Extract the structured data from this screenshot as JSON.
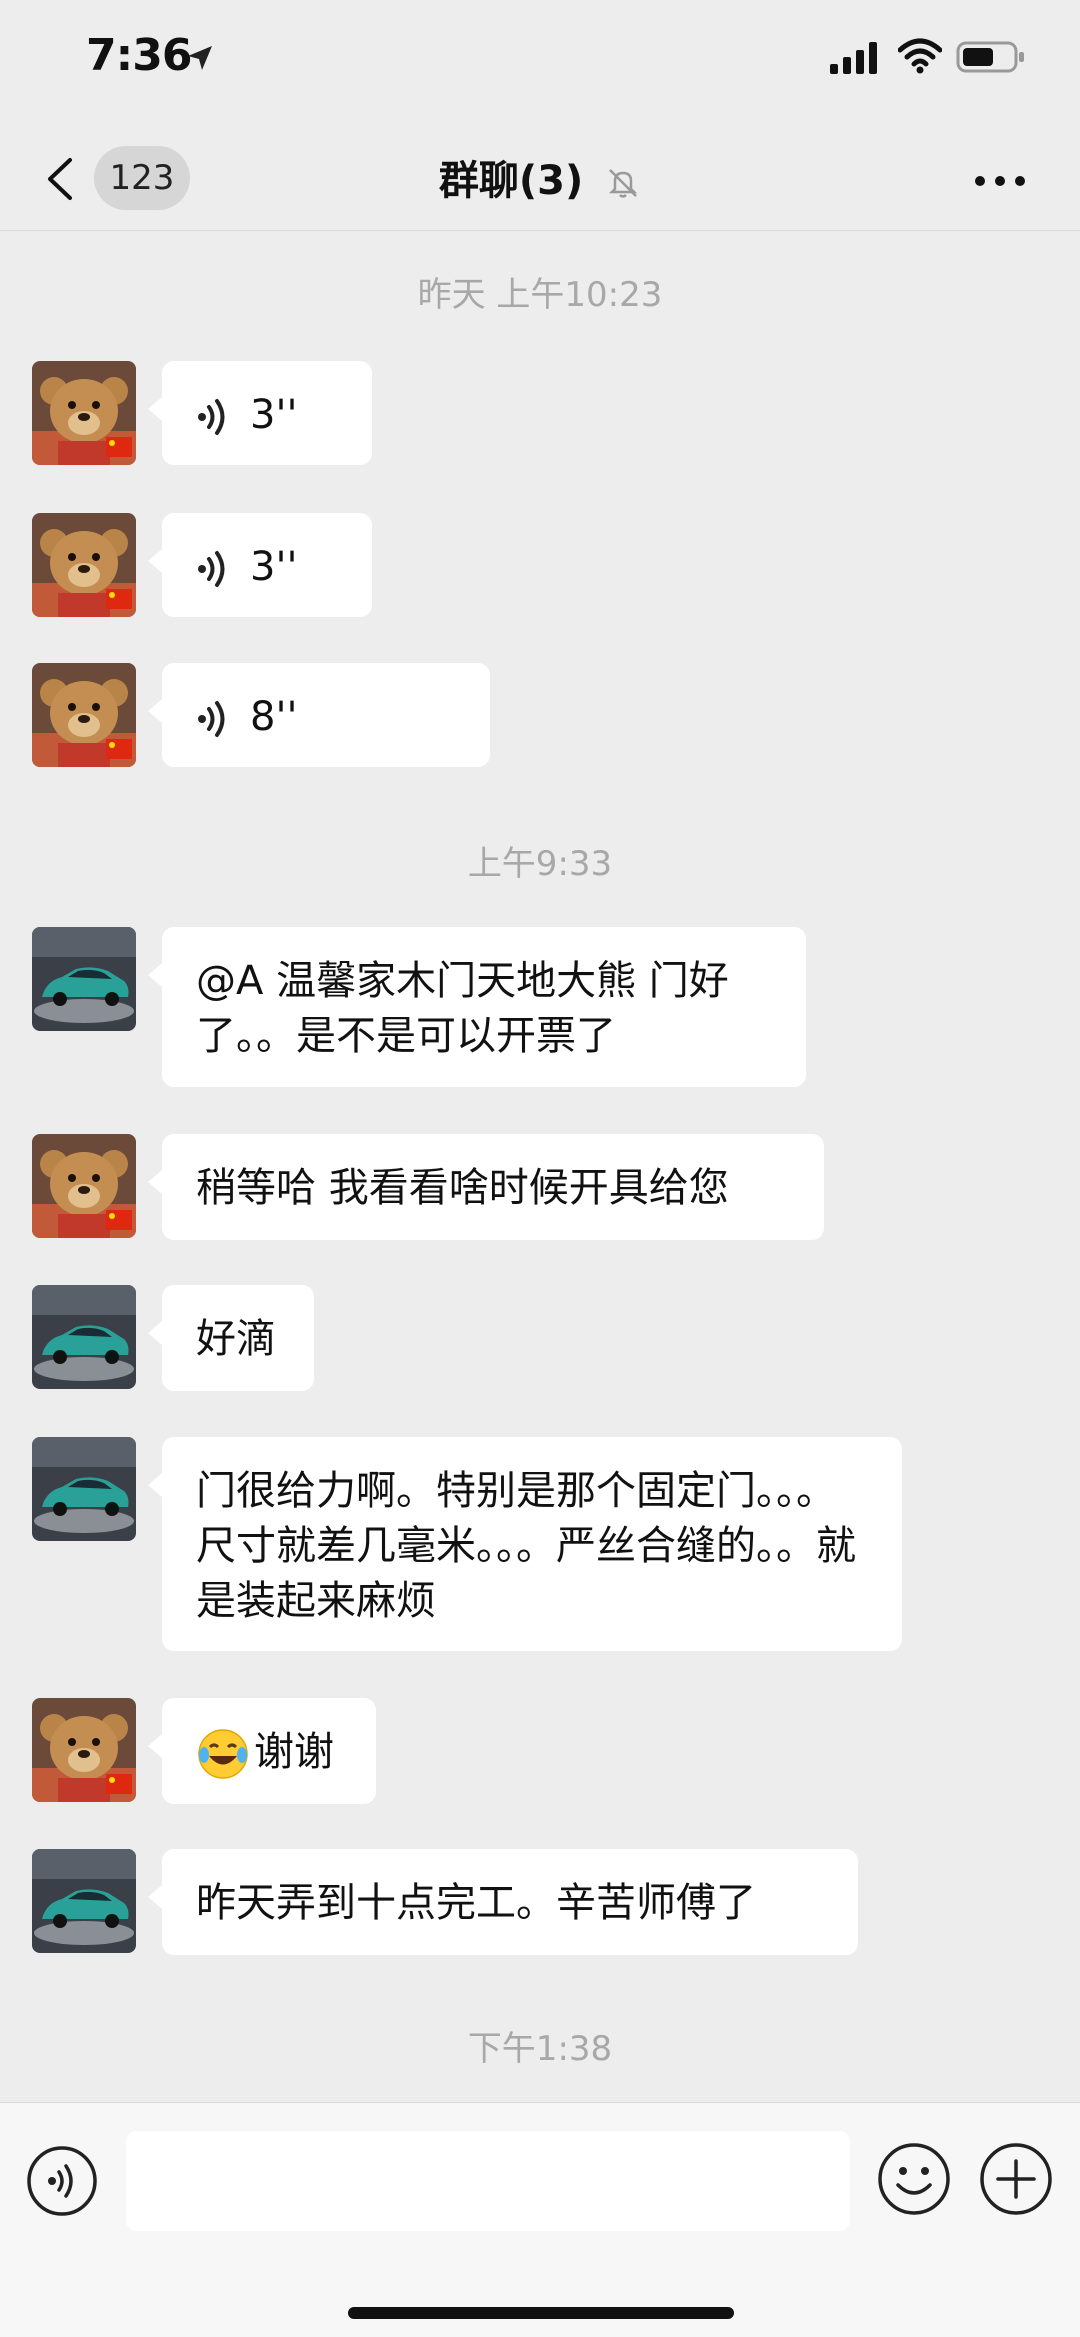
{
  "status_bar": {
    "time": "7:36"
  },
  "nav": {
    "unread_count": "123",
    "title": "群聊(3)"
  },
  "colors": {
    "background": "#ededed",
    "bubble": "#ffffff",
    "timestamp": "#a8a8a8"
  },
  "timestamps": [
    "昨天 上午10:23",
    "上午9:33",
    "下午1:38"
  ],
  "messages": [
    {
      "sender": "teddy-bear-avatar",
      "type": "voice",
      "duration": "3''"
    },
    {
      "sender": "teddy-bear-avatar",
      "type": "voice",
      "duration": "3''"
    },
    {
      "sender": "teddy-bear-avatar",
      "type": "voice",
      "duration": "8''"
    },
    {
      "sender": "car-avatar",
      "type": "text",
      "text": "@A 温馨家木门天地大熊 门好了。。是不是可以开票了"
    },
    {
      "sender": "teddy-bear-avatar",
      "type": "text",
      "text": "稍等哈 我看看啥时候开具给您"
    },
    {
      "sender": "car-avatar",
      "type": "text",
      "text": "好滴"
    },
    {
      "sender": "car-avatar",
      "type": "text",
      "text": "门很给力啊。特别是那个固定门。。。尺寸就差几毫米。。。严丝合缝的。。就是装起来麻烦"
    },
    {
      "sender": "teddy-bear-avatar",
      "type": "text",
      "emoji": "tears-of-joy-emoji-icon",
      "text": "谢谢"
    },
    {
      "sender": "car-avatar",
      "type": "text",
      "text": "昨天弄到十点完工。辛苦师傅了"
    }
  ],
  "input": {
    "value": "",
    "placeholder": ""
  }
}
